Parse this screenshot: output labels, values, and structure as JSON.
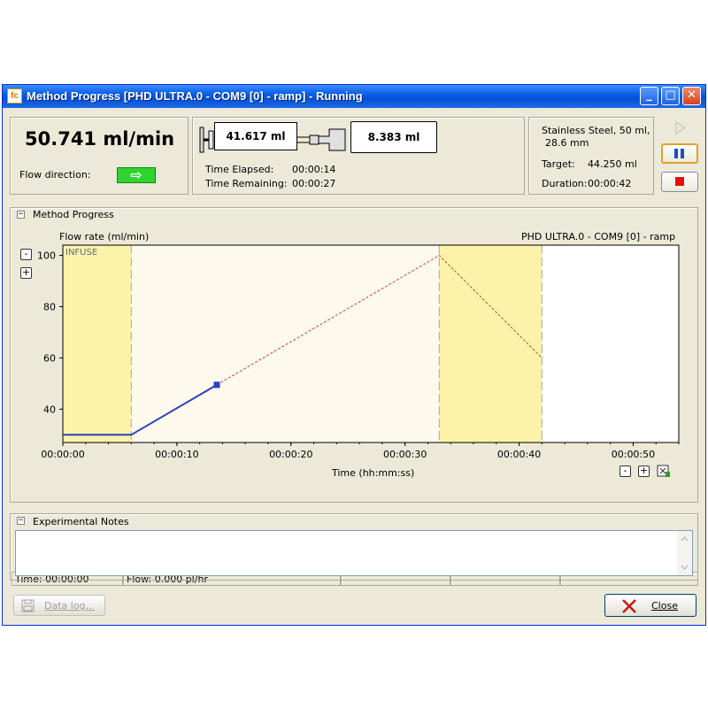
{
  "window": {
    "title": "Method Progress [PHD ULTRA.0 - COM9 [0] - ramp] - Running",
    "app_icon_text": "fc",
    "minimize": "_",
    "maximize": "□",
    "close": "✕"
  },
  "status_panel": {
    "flow_rate": "50.741 ml/min",
    "flow_direction_label": "Flow direction:",
    "direction_arrow": "⇨",
    "infused_volume": "41.617 ml",
    "remaining_volume": "8.383 ml",
    "time_elapsed_label": "Time Elapsed:",
    "time_elapsed": "00:00:14",
    "time_remaining_label": "Time Remaining:",
    "time_remaining": "00:00:27",
    "syringe_line1": "Stainless Steel, 50 ml,",
    "syringe_line2": "28.6 mm",
    "target_label": "Target:",
    "target": "44.250 ml",
    "duration_label": "Duration:",
    "duration": "00:00:42",
    "colors": {
      "arrow_green": "#2fd32f",
      "stop_red": "#e01010",
      "pause_blue": "#1b4fc8"
    }
  },
  "method_progress": {
    "section_title": "Method Progress",
    "collapse_glyph": "−",
    "zoom_out": "-",
    "zoom_in": "+"
  },
  "chart_data": {
    "type": "line",
    "ylabel": "Flow rate (ml/min)",
    "xlabel": "Time (hh:mm:ss)",
    "subtitle": "PHD ULTRA.0 - COM9 [0] - ramp",
    "phase_label": "INFUSE",
    "xlim": [
      0,
      54
    ],
    "ylim": [
      27,
      104
    ],
    "x_ticks": [
      {
        "v": 0,
        "label": "00:00:00"
      },
      {
        "v": 10,
        "label": "00:00:10"
      },
      {
        "v": 20,
        "label": "00:00:20"
      },
      {
        "v": 30,
        "label": "00:00:30"
      },
      {
        "v": 40,
        "label": "00:00:40"
      },
      {
        "v": 50,
        "label": "00:00:50"
      }
    ],
    "y_ticks": [
      {
        "v": 40,
        "label": "40"
      },
      {
        "v": 60,
        "label": "60"
      },
      {
        "v": 80,
        "label": "80"
      },
      {
        "v": 100,
        "label": "100"
      }
    ],
    "phases": [
      {
        "start": 0,
        "end": 6,
        "color": "#fdf3a8"
      },
      {
        "start": 6,
        "end": 33,
        "color": "#fdf9ec"
      },
      {
        "start": 33,
        "end": 42,
        "color": "#fdf3a8"
      }
    ],
    "series": [
      {
        "style": "actual",
        "color": "#2a3fbf",
        "points": [
          [
            0,
            30
          ],
          [
            6,
            30
          ],
          [
            13.5,
            49.5
          ]
        ]
      },
      {
        "style": "planned",
        "color": "#d04040",
        "points": [
          [
            13.5,
            49.5
          ],
          [
            33,
            100
          ],
          [
            42,
            60
          ]
        ]
      }
    ],
    "current_point": [
      13.5,
      49.5
    ]
  },
  "status_bar": {
    "time": "Time: 00:00:00",
    "flow": "Flow: 0.000 pl/hr"
  },
  "notes": {
    "section_title": "Experimental Notes",
    "text": ""
  },
  "footer": {
    "data_log": "Data log...",
    "close": "Close"
  }
}
